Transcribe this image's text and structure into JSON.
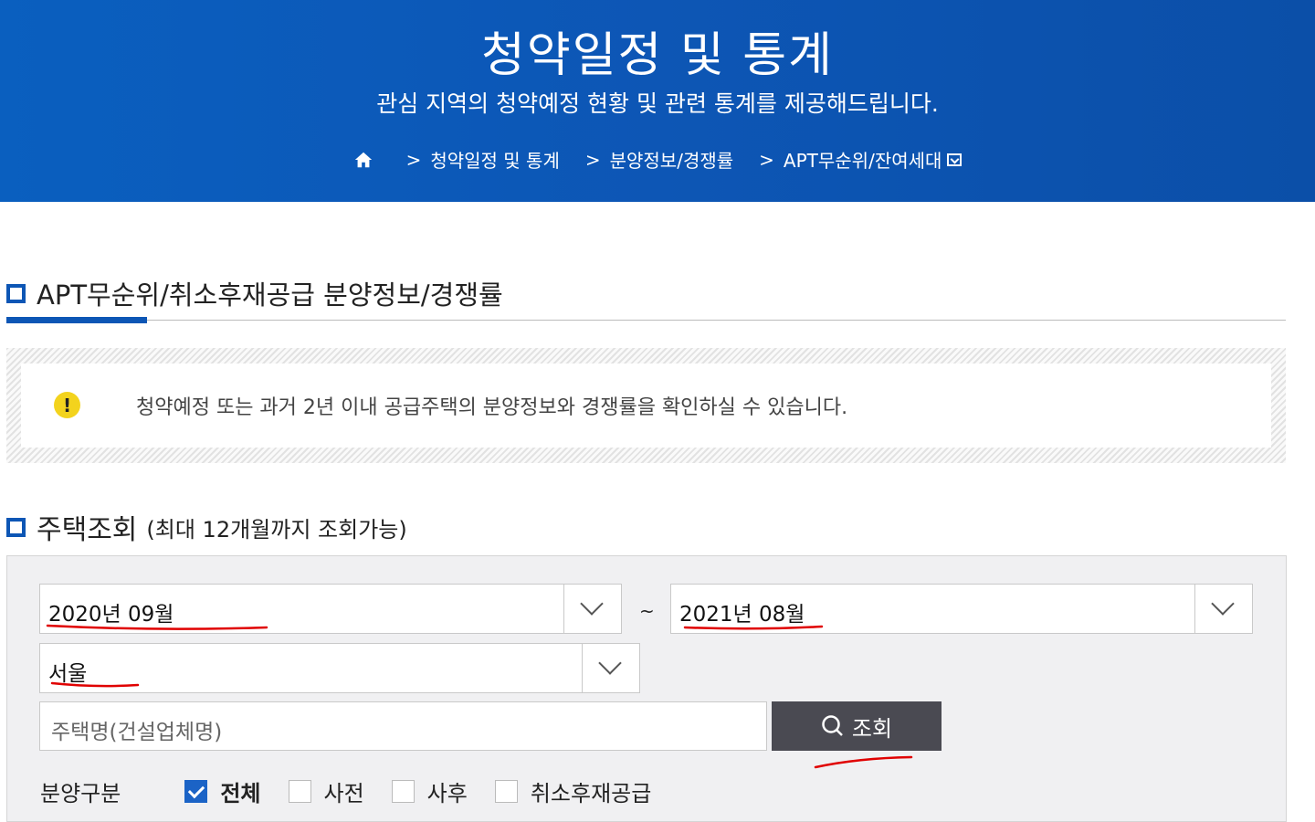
{
  "hero": {
    "title": "청약일정 및 통계",
    "subtitle": "관심 지역의 청약예정 현황 및 관련 통계를 제공해드립니다.",
    "breadcrumb": [
      "청약일정 및 통계",
      "분양정보/경쟁률",
      "APT무순위/잔여세대"
    ]
  },
  "section": {
    "title": "APT무순위/취소후재공급 분양정보/경쟁률"
  },
  "notice": {
    "text": "청약예정 또는 과거 2년 이내 공급주택의 분양정보와 경쟁률을 확인하실 수 있습니다."
  },
  "search": {
    "title": "주택조회",
    "subtitle": "(최대 12개월까지 조회가능)",
    "start_month": "2020년 09월",
    "range_separator": "~",
    "end_month": "2021년 08월",
    "region": "서울",
    "name_placeholder": "주택명(건설업체명)",
    "submit_label": "조회",
    "filter_label": "분양구분",
    "filter_options": [
      {
        "label": "전체",
        "checked": true
      },
      {
        "label": "사전",
        "checked": false
      },
      {
        "label": "사후",
        "checked": false
      },
      {
        "label": "취소후재공급",
        "checked": false
      }
    ]
  },
  "colors": {
    "brand": "#0d56b5",
    "checkbox_on": "#1b63c6",
    "warning": "#f3d31d",
    "annotation": "#e00000"
  }
}
